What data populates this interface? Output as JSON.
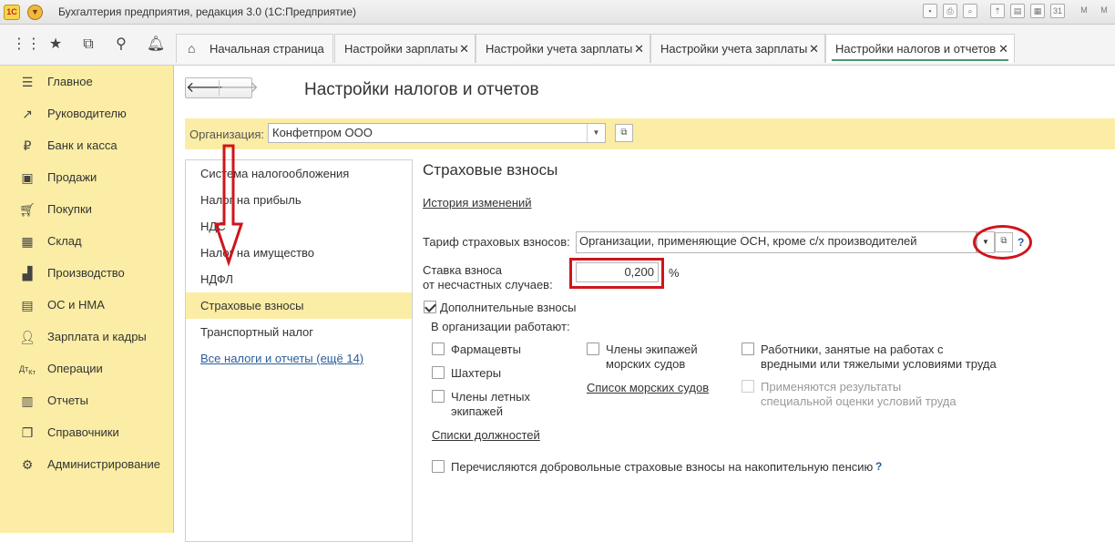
{
  "titlebar": {
    "logo": "1С",
    "title": "Бухгалтерия предприятия, редакция 3.0 (1С:Предприятие)"
  },
  "quick_icons": [
    "apps-grid-icon",
    "star-icon",
    "history-icon",
    "search-icon",
    "bell-icon"
  ],
  "tabs": [
    {
      "label": "Начальная страница",
      "icon": "home-icon"
    },
    {
      "label": "Настройки зарплаты",
      "close": "✕"
    },
    {
      "label": "Настройки учета зарплаты",
      "close": "✕"
    },
    {
      "label": "Настройки учета зарплаты",
      "close": "✕"
    },
    {
      "label": "Настройки налогов и отчетов",
      "close": "✕"
    }
  ],
  "sidebar": {
    "items": [
      {
        "label": "Главное",
        "icon": "menu-icon"
      },
      {
        "label": "Руководителю",
        "icon": "trend-icon"
      },
      {
        "label": "Банк и касса",
        "icon": "ruble-icon"
      },
      {
        "label": "Продажи",
        "icon": "bag-icon"
      },
      {
        "label": "Покупки",
        "icon": "cart-icon"
      },
      {
        "label": "Склад",
        "icon": "warehouse-icon"
      },
      {
        "label": "Производство",
        "icon": "factory-icon"
      },
      {
        "label": "ОС и НМА",
        "icon": "assets-icon"
      },
      {
        "label": "Зарплата и кадры",
        "icon": "people-icon"
      },
      {
        "label": "Операции",
        "icon": "dt-kt-icon"
      },
      {
        "label": "Отчеты",
        "icon": "report-icon"
      },
      {
        "label": "Справочники",
        "icon": "book-icon"
      },
      {
        "label": "Администрирование",
        "icon": "gear-icon"
      }
    ]
  },
  "page": {
    "title": "Настройки налогов и отчетов",
    "back": "🡐",
    "forward": "🡒"
  },
  "organization": {
    "label": "Организация:",
    "value": "Конфетпром ООО"
  },
  "left_list": {
    "items": [
      "Система налогообложения",
      "Налог на прибыль",
      "НДС",
      "Налог на имущество",
      "НДФЛ",
      "Страховые взносы",
      "Транспортный налог"
    ],
    "selected_index": 5,
    "all_link": "Все налоги и отчеты (ещё 14)"
  },
  "section": {
    "title": "Страховые взносы",
    "history_link": "История изменений",
    "tariff_label": "Тариф страховых взносов:",
    "tariff_value": "Организации, применяющие ОСН, кроме с/х производителей",
    "rate_label_1": "Ставка взноса",
    "rate_label_2": "от несчастных случаев:",
    "rate_value": "0,200",
    "rate_unit": "%",
    "additional_label": "Дополнительные взносы",
    "additional_checked": true,
    "works_label": "В организации работают:",
    "col1": [
      "Фармацевты",
      "Шахтеры",
      "Члены летных экипажей"
    ],
    "col1_link": "Списки должностей",
    "col2_line1": "Члены экипажей",
    "col2_line2": "морских судов",
    "col2_link": "Список морских судов",
    "col3_a_line1": "Работники, занятые на работах с",
    "col3_a_line2": "вредными или тяжелыми условиями труда",
    "col3_b_line1": "Применяются результаты",
    "col3_b_line2": "специальной оценки условий труда",
    "voluntary_label": "Перечисляются добровольные страховые взносы на накопительную пенсию",
    "help": "?"
  },
  "annotation_color": "#d0141b"
}
